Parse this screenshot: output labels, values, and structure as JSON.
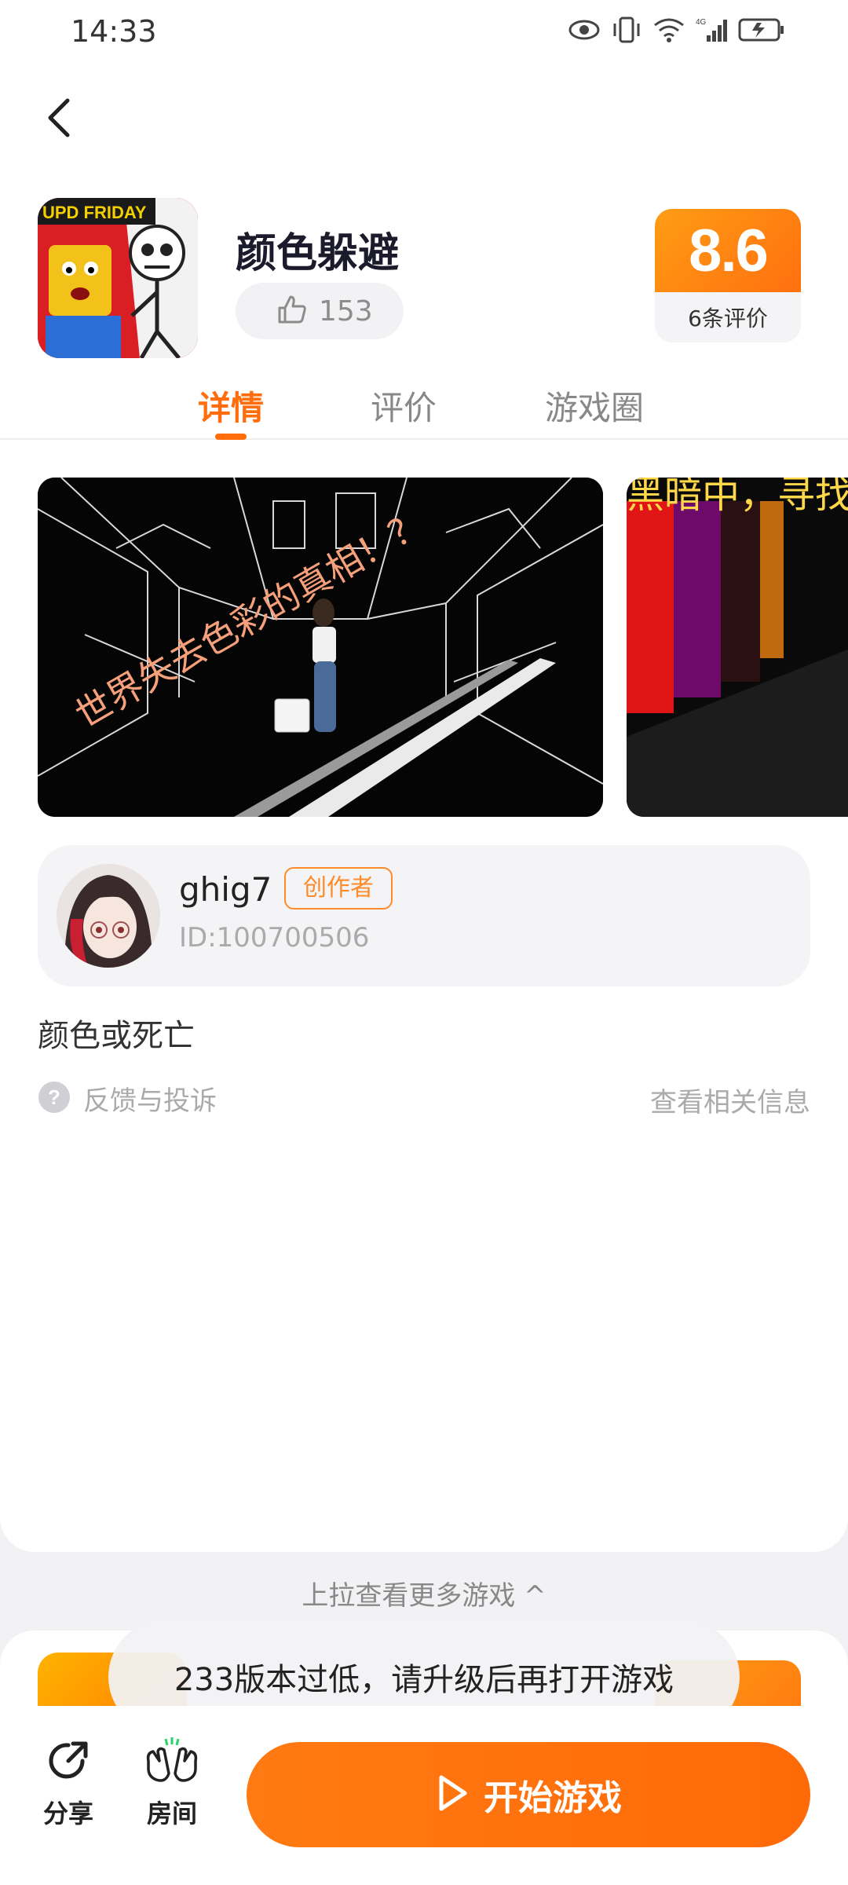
{
  "status_bar": {
    "time": "14:33"
  },
  "app": {
    "title": "颜色躲避",
    "icon_banner": "UPD FRIDAY",
    "likes": "153",
    "rating": {
      "score": "8.6",
      "count_label": "6条评价"
    }
  },
  "tabs": [
    {
      "label": "详情",
      "active": true
    },
    {
      "label": "评价",
      "active": false
    },
    {
      "label": "游戏圈",
      "active": false
    }
  ],
  "gallery": {
    "screenshot1_caption": "世界失去色彩的真相！？",
    "screenshot2_caption": "黑暗中，寻找"
  },
  "creator": {
    "name": "ghig7",
    "badge": "创作者",
    "id": "ID:100700506"
  },
  "description": "颜色或死亡",
  "feedback_label": "反馈与投诉",
  "related_link": "查看相关信息",
  "more_games": "上拉查看更多游戏 ^",
  "toast": "233版本过低，请升级后再打开游戏",
  "bottom_bar": {
    "share_label": "分享",
    "room_label": "房间",
    "start_label": "开始游戏"
  },
  "colors": {
    "accent": "#ff6d0c",
    "rating_gradient_start": "#ff9d14",
    "rating_gradient_end": "#ff6f0f"
  },
  "icons": [
    "back-arrow-icon",
    "thumbs-up-icon",
    "help-circle-icon",
    "share-icon",
    "room-hands-icon",
    "play-icon",
    "eye-icon",
    "vibrate-icon",
    "wifi-icon",
    "signal-icon",
    "battery-icon"
  ]
}
